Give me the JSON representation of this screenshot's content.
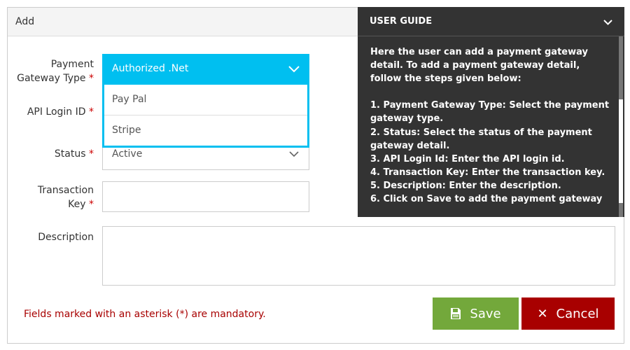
{
  "form": {
    "title": "Add",
    "payment_gateway_type_label_1": "Payment",
    "payment_gateway_type_label_2": "Gateway Type",
    "api_login_label": "API Login ID",
    "status_label": "Status",
    "transaction_key_label_1": "Transaction",
    "transaction_key_label_2": "Key",
    "description_label": "Description",
    "asterisk": "*",
    "gateway_selected": "Authorized .Net",
    "gateway_options": [
      "Pay Pal",
      "Stripe"
    ],
    "status_value": "Active",
    "api_login_value": "",
    "transaction_key_value": "",
    "description_value": "",
    "mandatory_note": "Fields marked with an asterisk (*) are mandatory.",
    "save_label": "Save",
    "cancel_label": "Cancel"
  },
  "guide": {
    "title": "USER GUIDE",
    "text": "Here the user can add a payment gateway detail. To add a payment gateway detail, follow the steps given below:\n\n1. Payment Gateway Type: Select the payment gateway type.\n2. Status: Select the status of the payment gateway detail.\n3. API Login Id: Enter the API login id.\n4. Transaction Key: Enter the transaction key.\n5. Description: Enter the description.\n6. Click on Save to add the payment gateway"
  },
  "colors": {
    "accent": "#00bff0",
    "save": "#73a83b",
    "cancel": "#a80000",
    "guide_bg": "#333333",
    "required": "#cc0000"
  }
}
